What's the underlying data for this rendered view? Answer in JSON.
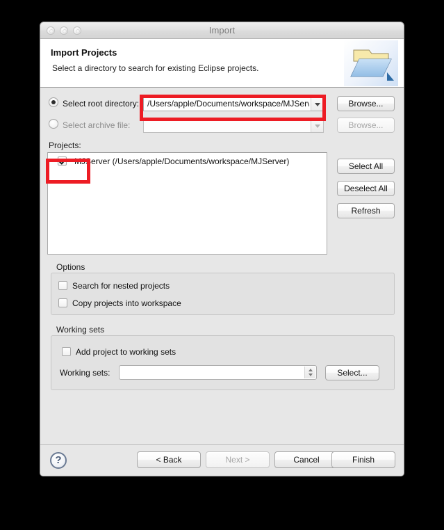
{
  "window": {
    "title": "Import",
    "traffic_lights": [
      "close",
      "minimize",
      "zoom"
    ]
  },
  "header": {
    "title": "Import Projects",
    "subtitle": "Select a directory to search for existing Eclipse projects.",
    "icon": "open-folder-icon"
  },
  "source": {
    "root_directory": {
      "label": "Select root directory:",
      "value": "/Users/apple/Documents/workspace/MJServe",
      "selected": true,
      "browse_label": "Browse..."
    },
    "archive_file": {
      "label": "Select archive file:",
      "value": "",
      "selected": false,
      "browse_label": "Browse...",
      "disabled": true
    }
  },
  "projects": {
    "label": "Projects:",
    "items": [
      {
        "name": "MJServer (/Users/apple/Documents/workspace/MJServer)",
        "checked": true
      }
    ],
    "buttons": {
      "select_all": "Select All",
      "deselect_all": "Deselect All",
      "refresh": "Refresh"
    }
  },
  "options": {
    "title": "Options",
    "checkboxes": [
      {
        "label": "Search for nested projects",
        "checked": false
      },
      {
        "label": "Copy projects into workspace",
        "checked": false
      }
    ]
  },
  "working_sets": {
    "title": "Working sets",
    "add_checkbox": {
      "label": "Add project to working sets",
      "checked": false
    },
    "field_label": "Working sets:",
    "field_value": "",
    "select_label": "Select..."
  },
  "footer": {
    "help": "?",
    "back": "< Back",
    "next": "Next >",
    "next_disabled": true,
    "cancel": "Cancel",
    "finish": "Finish"
  },
  "annotations": {
    "accent_color": "#ed1c24",
    "highlights": [
      "root-directory-combo",
      "project-checkbox"
    ]
  }
}
